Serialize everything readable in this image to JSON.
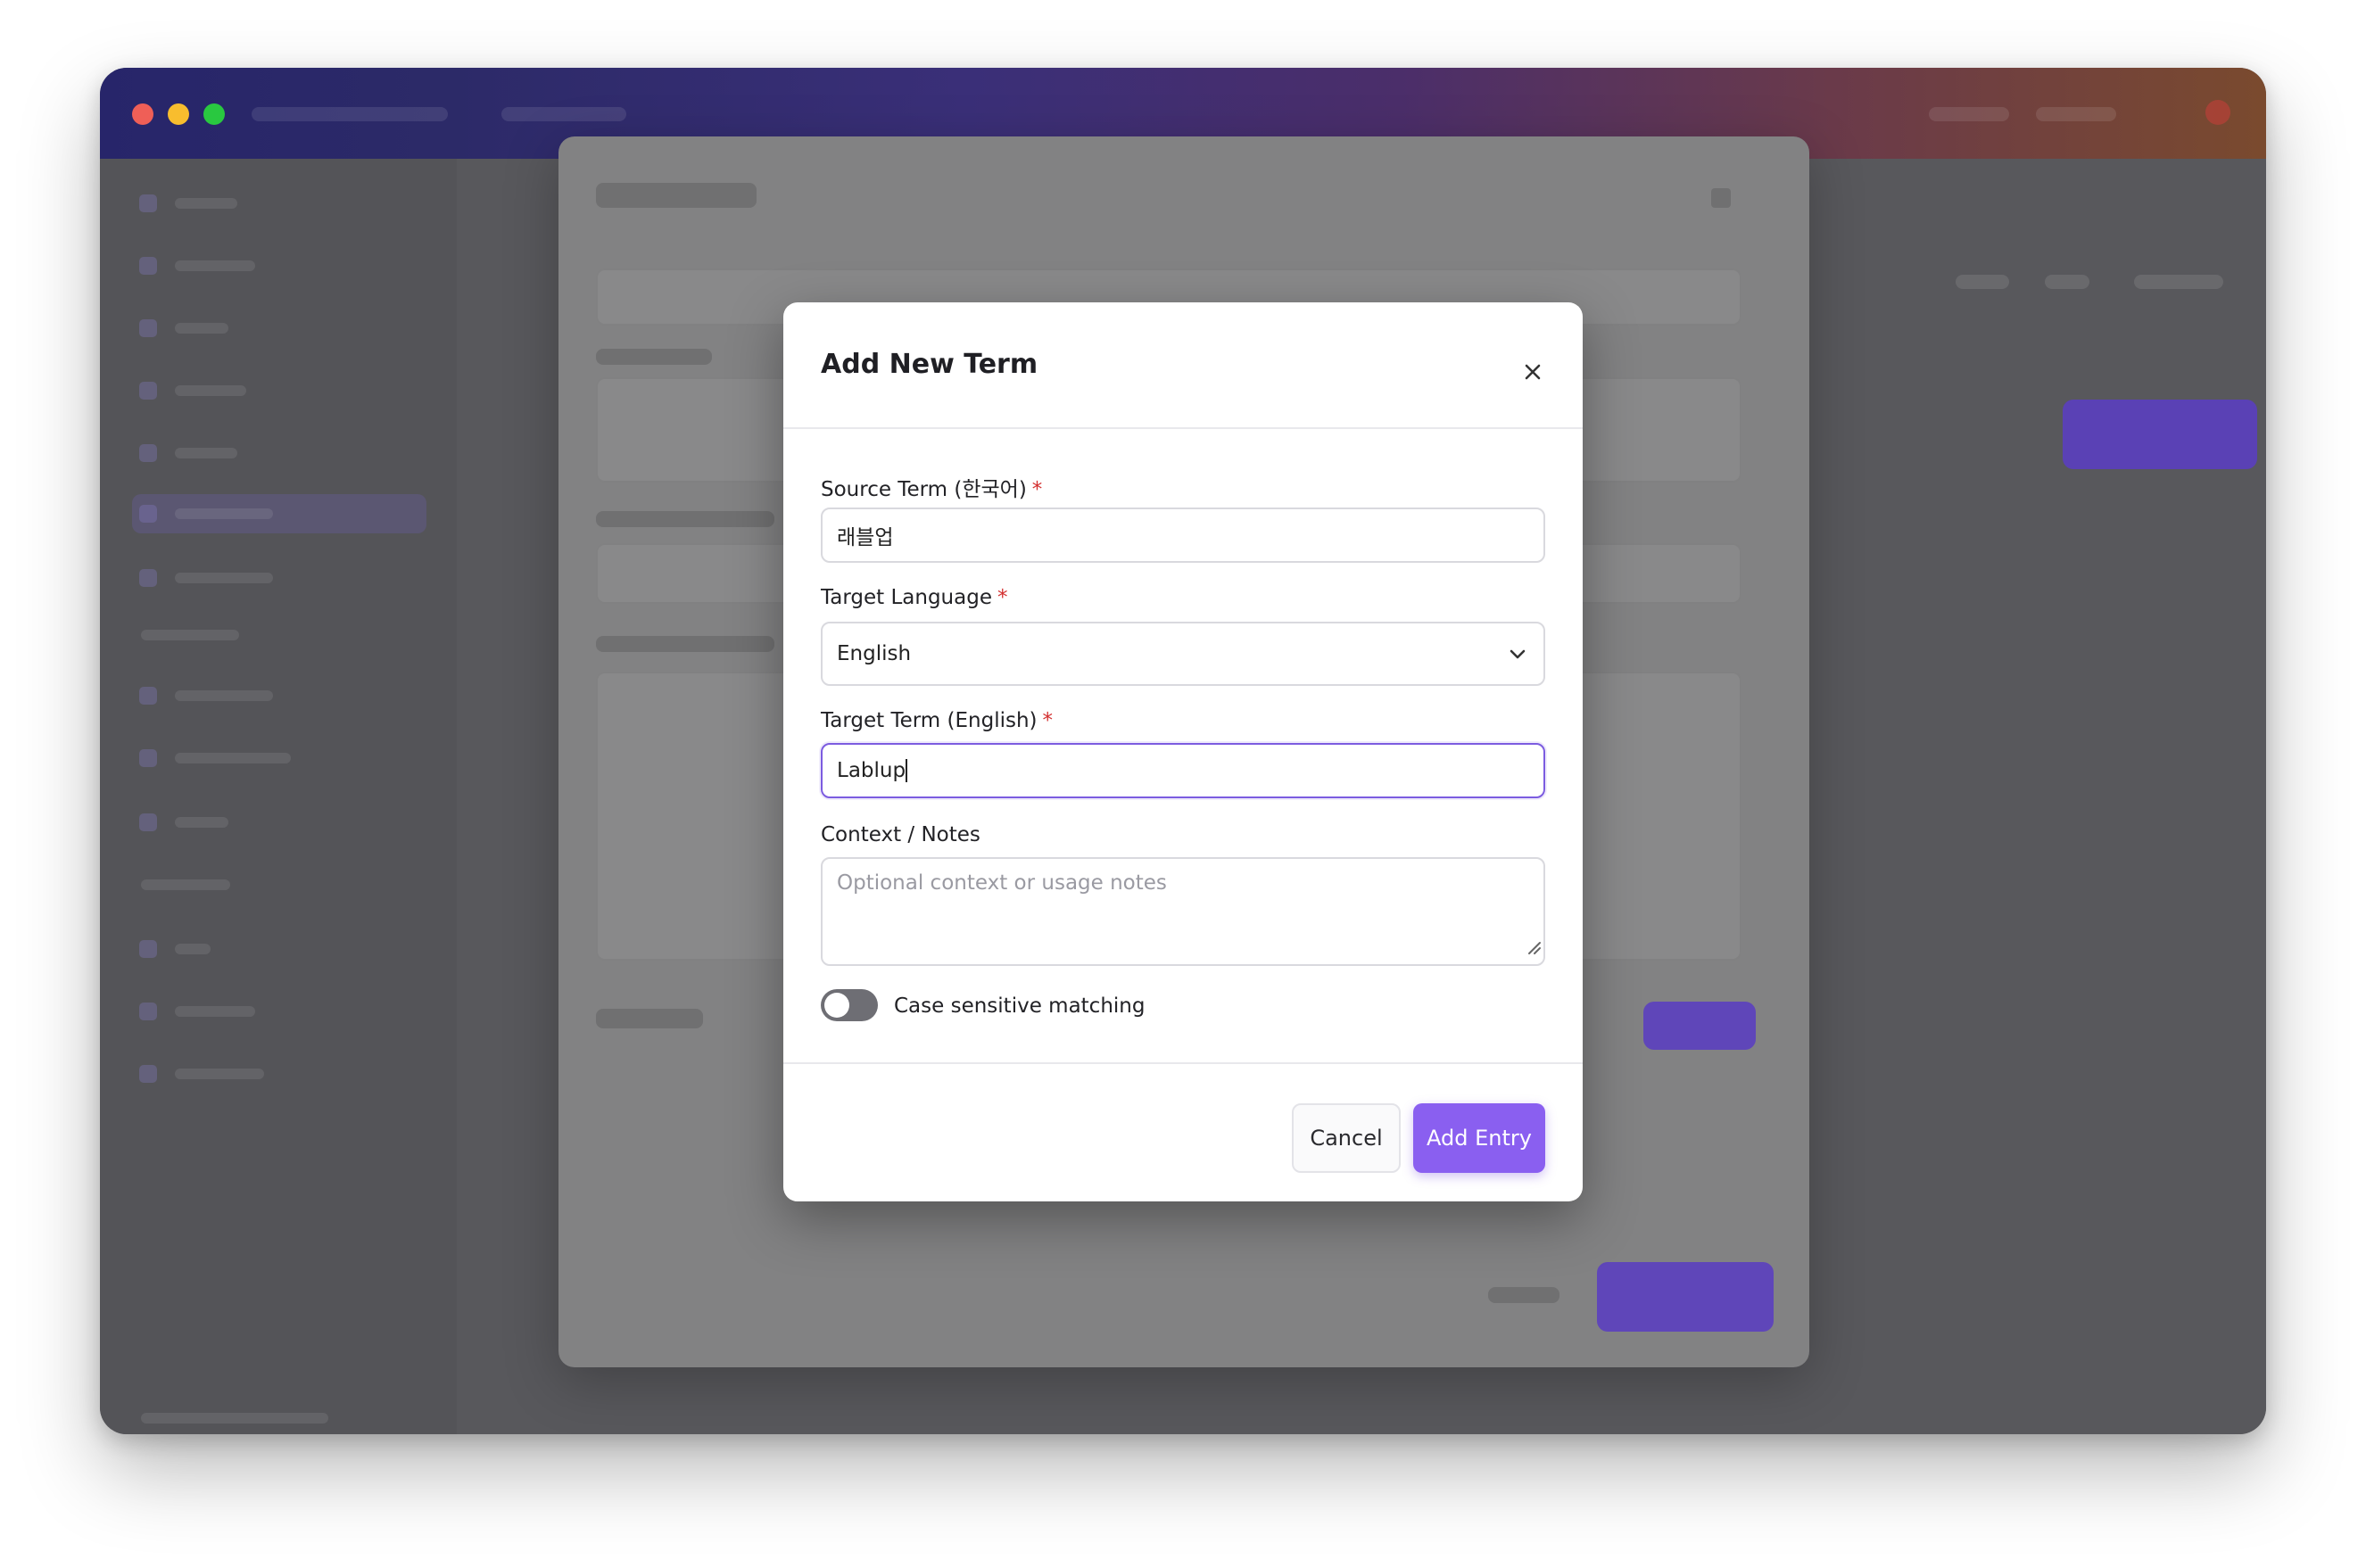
{
  "dialog": {
    "title": "Add New Term",
    "source_term": {
      "label": "Source Term (한국어)",
      "required_mark": "*",
      "value": "래블업"
    },
    "target_language": {
      "label": "Target Language",
      "required_mark": "*",
      "selected": "English"
    },
    "target_term": {
      "label": "Target Term (English)",
      "required_mark": "*",
      "value": "Lablup"
    },
    "context": {
      "label": "Context / Notes",
      "placeholder": "Optional context or usage notes"
    },
    "case_sensitive": {
      "label": "Case sensitive matching",
      "enabled": false
    },
    "cancel_label": "Cancel",
    "submit_label": "Add Entry"
  },
  "colors": {
    "accent": "#8a5ff0",
    "focus_border": "#7c5ce0",
    "required": "#d32f2f",
    "toggle_off": "#6e6e74"
  },
  "icons": {
    "close": "close-icon",
    "select": "chevron-down-icon",
    "resize": "resize-grip-icon"
  }
}
